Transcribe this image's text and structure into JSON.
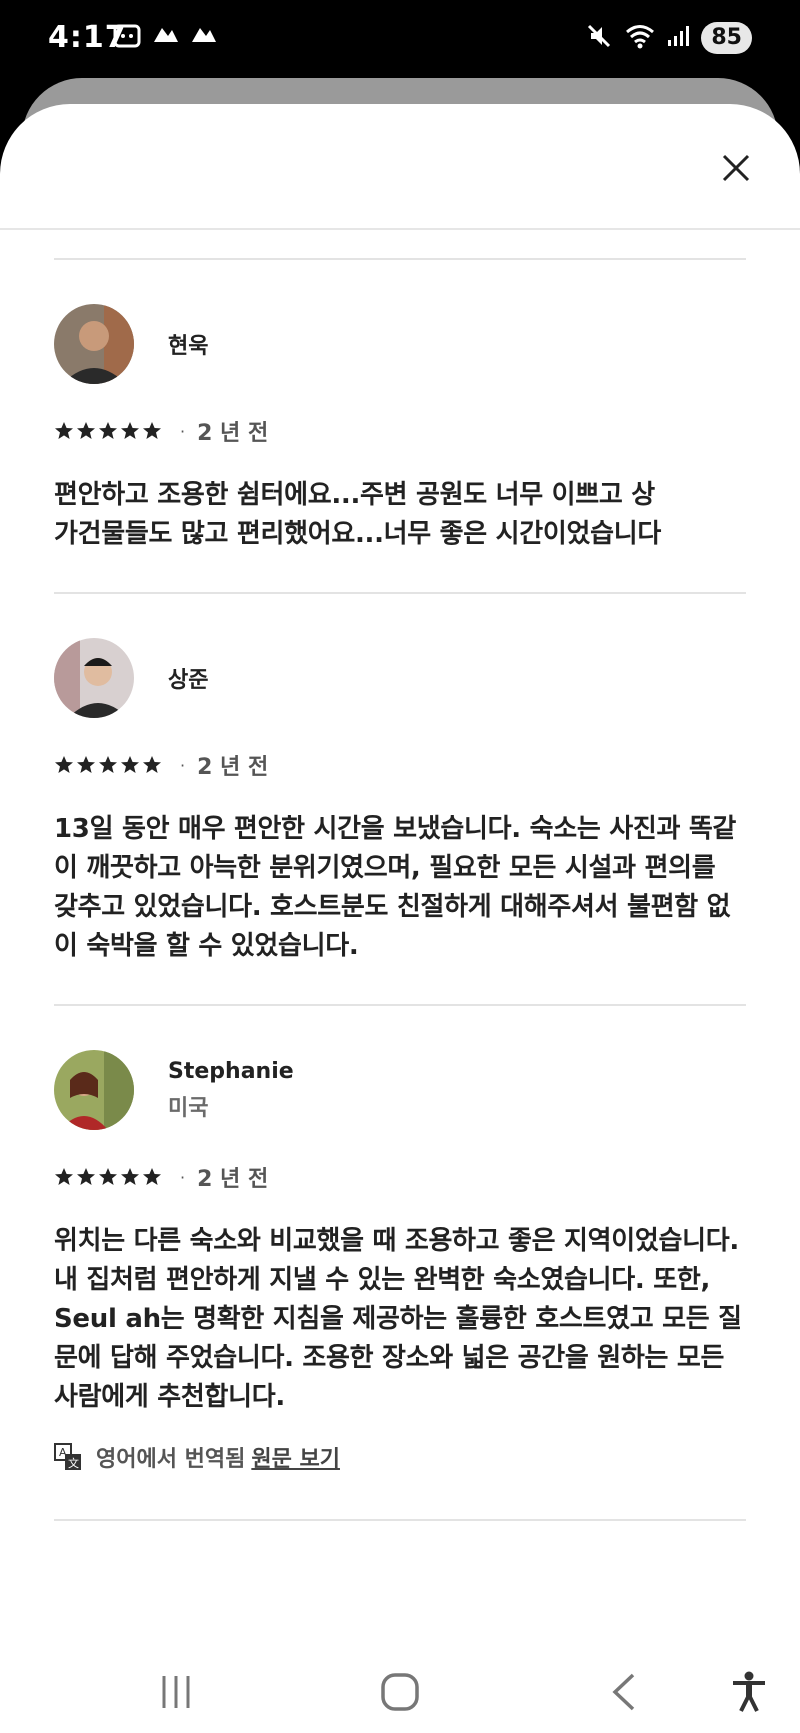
{
  "status_bar": {
    "time": "4:17",
    "battery": "85",
    "icons": [
      "screenshot-icon",
      "cloud-icon",
      "cloud-icon",
      "mute-icon",
      "wifi-icon",
      "signal-icon"
    ]
  },
  "reviews": [
    {
      "name": "현욱",
      "location": "",
      "rating": 5,
      "date": "2 년 전",
      "text": "편안하고 조용한 쉼터에요...주변 공원도 너무 이쁘고 상가건물들도 많고 편리했어요...너무 좋은 시간이었습니다"
    },
    {
      "name": "상준",
      "location": "",
      "rating": 5,
      "date": "2 년 전",
      "text": "13일 동안 매우 편안한 시간을 보냈습니다. 숙소는 사진과 똑같이 깨끗하고 아늑한 분위기였으며, 필요한 모든 시설과 편의를 갖추고 있었습니다. 호스트분도 친절하게 대해주셔서 불편함 없이 숙박을 할 수 있었습니다."
    },
    {
      "name": "Stephanie",
      "location": "미국",
      "rating": 5,
      "date": "2 년 전",
      "text": "위치는 다른 숙소와 비교했을 때 조용하고 좋은 지역이었습니다. 내 집처럼 편안하게 지낼 수 있는 완벽한 숙소였습니다. 또한, Seul ah는 명확한 지침을 제공하는 훌륭한 호스트였고 모든 질문에 답해 주었습니다. 조용한 장소와 넓은 공간을 원하는 모든 사람에게 추천합니다.",
      "translation_label": "영어에서 번역됨",
      "translation_link": "원문 보기"
    }
  ],
  "colors": {
    "text": "#222222",
    "muted": "#6a6a6a",
    "divider": "#e3e3e3"
  }
}
